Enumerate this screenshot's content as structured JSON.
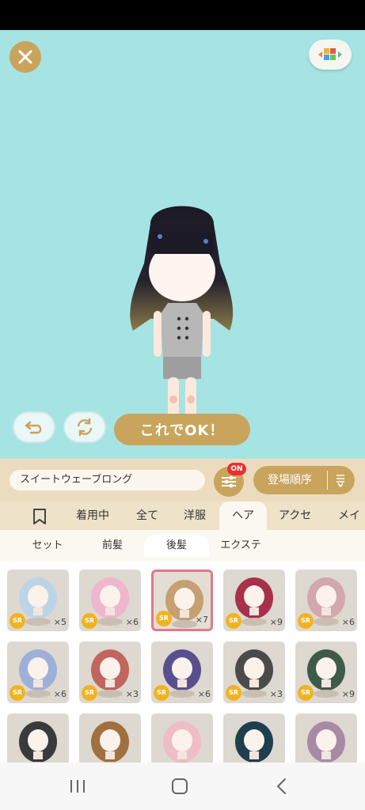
{
  "toolbar": {
    "item_name": "スイートウェーブロング",
    "filter_badge": "ON",
    "sort_label": "登場順序",
    "ok_button": "これでOK！"
  },
  "tabs": [
    {
      "label": "着用中"
    },
    {
      "label": "全て"
    },
    {
      "label": "洋服"
    },
    {
      "label": "ヘア"
    },
    {
      "label": "アクセ"
    },
    {
      "label": "メイク"
    }
  ],
  "subtabs": [
    {
      "label": "セット"
    },
    {
      "label": "前髪"
    },
    {
      "label": "後髪"
    },
    {
      "label": "エクステ"
    }
  ],
  "items": [
    {
      "rarity": "SR",
      "count": "×5",
      "hair": "#bcd4e6"
    },
    {
      "rarity": "SR",
      "count": "×6",
      "hair": "#efb6cc"
    },
    {
      "rarity": "SR",
      "count": "×7",
      "hair": "#c6a070"
    },
    {
      "rarity": "SR",
      "count": "×9",
      "hair": "#a8304a"
    },
    {
      "rarity": "SR",
      "count": "×6",
      "hair": "#d2a8ac"
    },
    {
      "rarity": "SR",
      "count": "×6",
      "hair": "#9fb0d8"
    },
    {
      "rarity": "SR",
      "count": "×3",
      "hair": "#c2655e"
    },
    {
      "rarity": "SR",
      "count": "×6",
      "hair": "#5a4f8e"
    },
    {
      "rarity": "SR",
      "count": "×3",
      "hair": "#4b4b4b"
    },
    {
      "rarity": "SR",
      "count": "×9",
      "hair": "#3f5a48"
    },
    {
      "hair": "#3a3a3a"
    },
    {
      "hair": "#a0703e"
    },
    {
      "hair": "#f0bcc6"
    },
    {
      "hair": "#1e3f4e"
    },
    {
      "hair": "#a88aa6"
    }
  ],
  "colors": {
    "accent": "#c9a45c",
    "stage_bg": "#a6e3e3",
    "badge_red": "#e6322f",
    "sr_gold": "#f2b322",
    "selected_border": "#e07a8a"
  },
  "icons": [
    "close-icon",
    "color-grid-icon",
    "undo-icon",
    "refresh-icon",
    "filter-icon",
    "sort-icon",
    "bookmark-icon",
    "nav-recent-icon",
    "nav-home-icon",
    "nav-back-icon"
  ]
}
